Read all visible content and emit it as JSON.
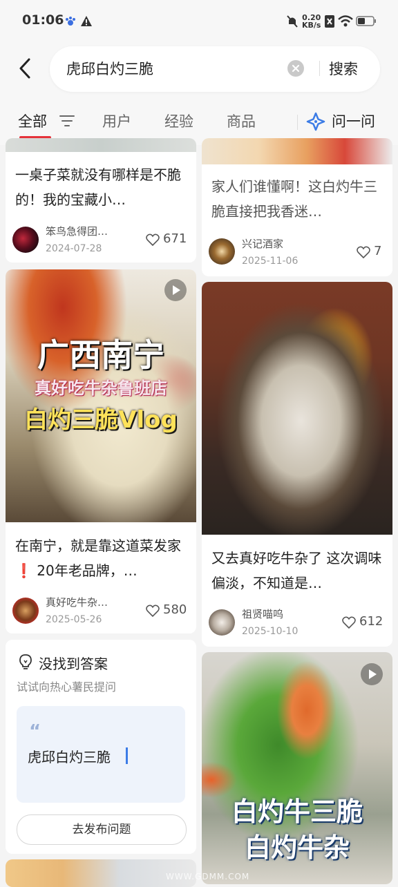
{
  "status_bar": {
    "time": "01:06",
    "net_speed_value": "0.20",
    "net_speed_unit": "KB/s"
  },
  "search": {
    "query": "虎邱白灼三脆",
    "button": "搜索"
  },
  "tabs": [
    {
      "label": "全部"
    },
    {
      "label": "用户"
    },
    {
      "label": "经验"
    },
    {
      "label": "商品"
    }
  ],
  "ask_label": "问一问",
  "colors": {
    "accent": "#e5323a",
    "bg": "#f4f4f4",
    "link_blue": "#3c7ce6"
  },
  "cards": [
    {
      "title": "一桌子菜就没有哪样是不脆的！我的宝藏小…",
      "author": "笨鸟急得团…",
      "date": "2024-07-28",
      "likes": "671"
    },
    {
      "title": "家人们谁懂啊！这白灼牛三脆直接把我香迷…",
      "author": "兴记酒家",
      "date": "2025-11-06",
      "likes": "7"
    },
    {
      "title": "在南宁，就是靠这道菜发家❗ 20年老品牌，…",
      "author": "真好吃牛杂…",
      "date": "2025-05-26",
      "likes": "580",
      "overlay": [
        "广西南宁",
        "真好吃牛杂鲁班店",
        "白灼三脆Vlog"
      ]
    },
    {
      "title": "又去真好吃牛杂了 这次调味偏淡，不知道是…",
      "author": "祖贤喵呜",
      "date": "2025-10-10",
      "likes": "612"
    },
    {
      "overlay": [
        "白灼牛三脆",
        "白灼牛杂"
      ]
    }
  ],
  "question": {
    "title": "没找到答案",
    "subtitle": "试试向热心薯民提问",
    "draft": "虎邱白灼三脆",
    "button": "去发布问题"
  },
  "watermark": "WWW.GDMM.COM"
}
